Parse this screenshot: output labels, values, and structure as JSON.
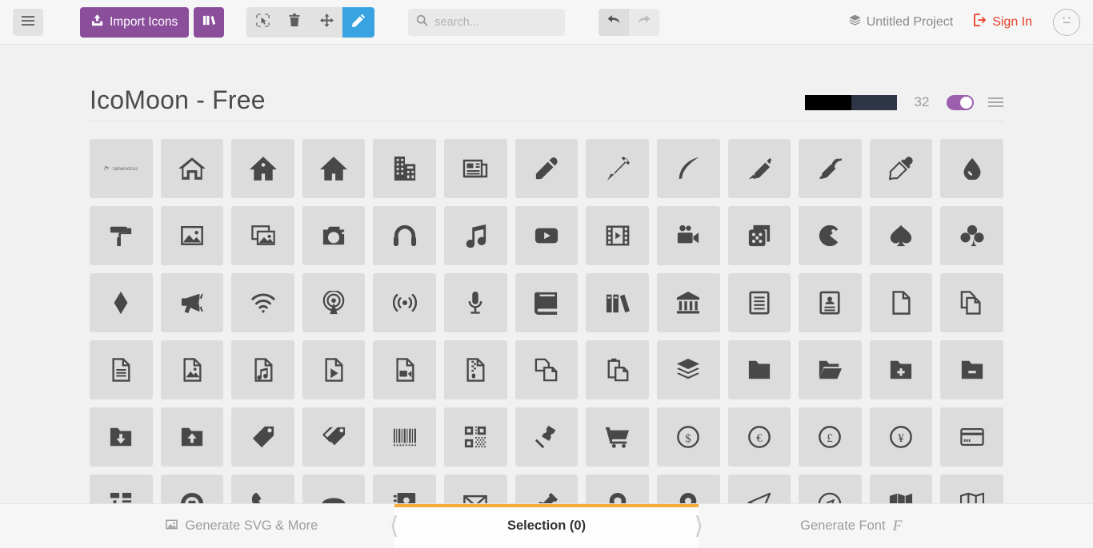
{
  "toolbar": {
    "menu_icon": "hamburger-icon",
    "import_label": "Import Icons",
    "library_icon": "library-icon",
    "tools": [
      {
        "name": "select-tool",
        "icon": "cursor-select-icon",
        "active": false
      },
      {
        "name": "delete-tool",
        "icon": "trash-icon",
        "active": false
      },
      {
        "name": "move-tool",
        "icon": "move-arrows-icon",
        "active": false
      },
      {
        "name": "edit-tool",
        "icon": "pencil-icon",
        "active": true
      }
    ],
    "search_placeholder": "search...",
    "search_value": "",
    "search_icon": "search-icon",
    "undo_icon": "undo-arrow-icon",
    "redo_icon": "redo-arrow-icon",
    "project_label": "Untitled Project",
    "project_icon": "layers-icon",
    "signin_label": "Sign In",
    "signin_icon": "login-icon",
    "avatar_icon": "neutral-face-icon",
    "accent_purple": "#8b4e9b",
    "accent_blue": "#38a3e0",
    "accent_red": "#e8402a"
  },
  "set": {
    "title": "IcoMoon - Free",
    "glyph_count": "32",
    "swatches": [
      "#000000",
      "#2d3547"
    ],
    "toggle_on": true,
    "toggle_color": "#9c5fad",
    "menu_icon": "set-menu-icon"
  },
  "icons": [
    {
      "name": "tailwindcss",
      "type": "wordmark",
      "text": "tailwindcss"
    },
    {
      "name": "home"
    },
    {
      "name": "home2"
    },
    {
      "name": "home3"
    },
    {
      "name": "office"
    },
    {
      "name": "newspaper"
    },
    {
      "name": "pencil"
    },
    {
      "name": "pencil2"
    },
    {
      "name": "quill"
    },
    {
      "name": "pen"
    },
    {
      "name": "blog"
    },
    {
      "name": "eyedropper"
    },
    {
      "name": "droplet"
    },
    {
      "name": "paint-format"
    },
    {
      "name": "image"
    },
    {
      "name": "images"
    },
    {
      "name": "camera"
    },
    {
      "name": "headphones"
    },
    {
      "name": "music"
    },
    {
      "name": "play"
    },
    {
      "name": "film"
    },
    {
      "name": "video-camera"
    },
    {
      "name": "dice"
    },
    {
      "name": "pacman"
    },
    {
      "name": "spades"
    },
    {
      "name": "clubs"
    },
    {
      "name": "diamonds"
    },
    {
      "name": "bullhorn"
    },
    {
      "name": "connection"
    },
    {
      "name": "podcast"
    },
    {
      "name": "feed"
    },
    {
      "name": "mic"
    },
    {
      "name": "book"
    },
    {
      "name": "books"
    },
    {
      "name": "library"
    },
    {
      "name": "file-text"
    },
    {
      "name": "profile"
    },
    {
      "name": "file-empty"
    },
    {
      "name": "files-empty"
    },
    {
      "name": "file-text2"
    },
    {
      "name": "file-picture"
    },
    {
      "name": "file-music"
    },
    {
      "name": "file-play"
    },
    {
      "name": "file-video"
    },
    {
      "name": "file-zip"
    },
    {
      "name": "copy"
    },
    {
      "name": "paste"
    },
    {
      "name": "stack"
    },
    {
      "name": "folder"
    },
    {
      "name": "folder-open"
    },
    {
      "name": "folder-plus"
    },
    {
      "name": "folder-minus"
    },
    {
      "name": "folder-download"
    },
    {
      "name": "folder-upload"
    },
    {
      "name": "price-tag"
    },
    {
      "name": "price-tags"
    },
    {
      "name": "barcode"
    },
    {
      "name": "qrcode"
    },
    {
      "name": "ticket"
    },
    {
      "name": "cart"
    },
    {
      "name": "coin-dollar"
    },
    {
      "name": "coin-euro"
    },
    {
      "name": "coin-pound"
    },
    {
      "name": "coin-yen"
    },
    {
      "name": "credit-card"
    },
    {
      "name": "calculator"
    },
    {
      "name": "lifebuoy"
    },
    {
      "name": "phone"
    },
    {
      "name": "phone-hang-up"
    },
    {
      "name": "address-book"
    },
    {
      "name": "envelop"
    },
    {
      "name": "pushpin"
    },
    {
      "name": "location"
    },
    {
      "name": "location2"
    },
    {
      "name": "compass"
    },
    {
      "name": "compass2"
    },
    {
      "name": "map"
    },
    {
      "name": "map2"
    }
  ],
  "footer": {
    "generate_svg_label": "Generate SVG & More",
    "generate_svg_icon": "image-icon",
    "selection_label": "Selection (0)",
    "generate_font_label": "Generate Font",
    "generate_font_icon": "font-f-icon",
    "active_tab_underline": "#f5aa39"
  }
}
